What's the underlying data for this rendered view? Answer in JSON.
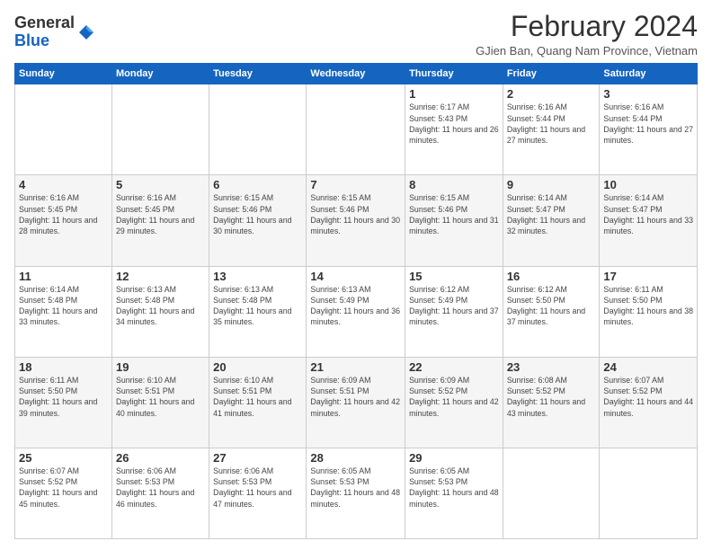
{
  "logo": {
    "general": "General",
    "blue": "Blue"
  },
  "header": {
    "title": "February 2024",
    "subtitle": "GJien Ban, Quang Nam Province, Vietnam"
  },
  "days_of_week": [
    "Sunday",
    "Monday",
    "Tuesday",
    "Wednesday",
    "Thursday",
    "Friday",
    "Saturday"
  ],
  "weeks": [
    [
      {
        "day": "",
        "info": ""
      },
      {
        "day": "",
        "info": ""
      },
      {
        "day": "",
        "info": ""
      },
      {
        "day": "",
        "info": ""
      },
      {
        "day": "1",
        "info": "Sunrise: 6:17 AM\nSunset: 5:43 PM\nDaylight: 11 hours and 26 minutes."
      },
      {
        "day": "2",
        "info": "Sunrise: 6:16 AM\nSunset: 5:44 PM\nDaylight: 11 hours and 27 minutes."
      },
      {
        "day": "3",
        "info": "Sunrise: 6:16 AM\nSunset: 5:44 PM\nDaylight: 11 hours and 27 minutes."
      }
    ],
    [
      {
        "day": "4",
        "info": "Sunrise: 6:16 AM\nSunset: 5:45 PM\nDaylight: 11 hours and 28 minutes."
      },
      {
        "day": "5",
        "info": "Sunrise: 6:16 AM\nSunset: 5:45 PM\nDaylight: 11 hours and 29 minutes."
      },
      {
        "day": "6",
        "info": "Sunrise: 6:15 AM\nSunset: 5:46 PM\nDaylight: 11 hours and 30 minutes."
      },
      {
        "day": "7",
        "info": "Sunrise: 6:15 AM\nSunset: 5:46 PM\nDaylight: 11 hours and 30 minutes."
      },
      {
        "day": "8",
        "info": "Sunrise: 6:15 AM\nSunset: 5:46 PM\nDaylight: 11 hours and 31 minutes."
      },
      {
        "day": "9",
        "info": "Sunrise: 6:14 AM\nSunset: 5:47 PM\nDaylight: 11 hours and 32 minutes."
      },
      {
        "day": "10",
        "info": "Sunrise: 6:14 AM\nSunset: 5:47 PM\nDaylight: 11 hours and 33 minutes."
      }
    ],
    [
      {
        "day": "11",
        "info": "Sunrise: 6:14 AM\nSunset: 5:48 PM\nDaylight: 11 hours and 33 minutes."
      },
      {
        "day": "12",
        "info": "Sunrise: 6:13 AM\nSunset: 5:48 PM\nDaylight: 11 hours and 34 minutes."
      },
      {
        "day": "13",
        "info": "Sunrise: 6:13 AM\nSunset: 5:48 PM\nDaylight: 11 hours and 35 minutes."
      },
      {
        "day": "14",
        "info": "Sunrise: 6:13 AM\nSunset: 5:49 PM\nDaylight: 11 hours and 36 minutes."
      },
      {
        "day": "15",
        "info": "Sunrise: 6:12 AM\nSunset: 5:49 PM\nDaylight: 11 hours and 37 minutes."
      },
      {
        "day": "16",
        "info": "Sunrise: 6:12 AM\nSunset: 5:50 PM\nDaylight: 11 hours and 37 minutes."
      },
      {
        "day": "17",
        "info": "Sunrise: 6:11 AM\nSunset: 5:50 PM\nDaylight: 11 hours and 38 minutes."
      }
    ],
    [
      {
        "day": "18",
        "info": "Sunrise: 6:11 AM\nSunset: 5:50 PM\nDaylight: 11 hours and 39 minutes."
      },
      {
        "day": "19",
        "info": "Sunrise: 6:10 AM\nSunset: 5:51 PM\nDaylight: 11 hours and 40 minutes."
      },
      {
        "day": "20",
        "info": "Sunrise: 6:10 AM\nSunset: 5:51 PM\nDaylight: 11 hours and 41 minutes."
      },
      {
        "day": "21",
        "info": "Sunrise: 6:09 AM\nSunset: 5:51 PM\nDaylight: 11 hours and 42 minutes."
      },
      {
        "day": "22",
        "info": "Sunrise: 6:09 AM\nSunset: 5:52 PM\nDaylight: 11 hours and 42 minutes."
      },
      {
        "day": "23",
        "info": "Sunrise: 6:08 AM\nSunset: 5:52 PM\nDaylight: 11 hours and 43 minutes."
      },
      {
        "day": "24",
        "info": "Sunrise: 6:07 AM\nSunset: 5:52 PM\nDaylight: 11 hours and 44 minutes."
      }
    ],
    [
      {
        "day": "25",
        "info": "Sunrise: 6:07 AM\nSunset: 5:52 PM\nDaylight: 11 hours and 45 minutes."
      },
      {
        "day": "26",
        "info": "Sunrise: 6:06 AM\nSunset: 5:53 PM\nDaylight: 11 hours and 46 minutes."
      },
      {
        "day": "27",
        "info": "Sunrise: 6:06 AM\nSunset: 5:53 PM\nDaylight: 11 hours and 47 minutes."
      },
      {
        "day": "28",
        "info": "Sunrise: 6:05 AM\nSunset: 5:53 PM\nDaylight: 11 hours and 48 minutes."
      },
      {
        "day": "29",
        "info": "Sunrise: 6:05 AM\nSunset: 5:53 PM\nDaylight: 11 hours and 48 minutes."
      },
      {
        "day": "",
        "info": ""
      },
      {
        "day": "",
        "info": ""
      }
    ]
  ]
}
